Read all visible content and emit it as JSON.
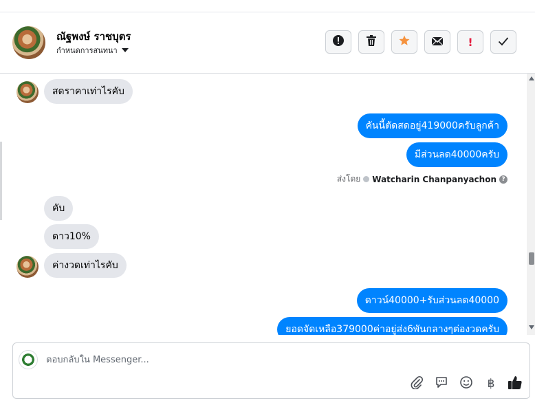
{
  "header": {
    "contact_name": "ณัฐพงษ์ ราชบุตร",
    "settings_label": "กำหนดการสนทนา",
    "toolbar": [
      {
        "name": "alert-circle-icon",
        "label": "!"
      },
      {
        "name": "trash-icon",
        "label": ""
      },
      {
        "name": "star-icon",
        "label": ""
      },
      {
        "name": "mail-icon",
        "label": ""
      },
      {
        "name": "exclamation-icon",
        "label": "!"
      },
      {
        "name": "checkmark-icon",
        "label": ""
      }
    ]
  },
  "messages": [
    {
      "side": "in",
      "text": "สดราคาเท่าไรคับ"
    },
    {
      "side": "out",
      "text": "คันนี้ตัดสดอยู่419000ครับลูกค้า"
    },
    {
      "side": "out",
      "text": "มีส่วนลด40000ครับ"
    },
    {
      "side": "in",
      "text": "คับ"
    },
    {
      "side": "in",
      "text": "ดาว10%"
    },
    {
      "side": "in",
      "text": "ค่างวดเท่าไรคับ"
    },
    {
      "side": "out",
      "text": "ดาวน์40000+รับส่วนลด40000"
    },
    {
      "side": "out",
      "text": "ยอดจัดเหลือ379000ค่าอยู่ส่ง6พันกลางๆต่องวดครับ"
    }
  ],
  "sent_by": {
    "prefix": "ส่งโดย",
    "name": "Watcharin Chanpanyachon"
  },
  "composer": {
    "placeholder": "ตอบกลับใน Messenger...",
    "currency_symbol": "฿"
  },
  "colors": {
    "outgoing_bubble": "#0084ff",
    "incoming_bubble": "#e4e6eb",
    "star": "#f5923e",
    "exclamation": "#e41e3f"
  }
}
